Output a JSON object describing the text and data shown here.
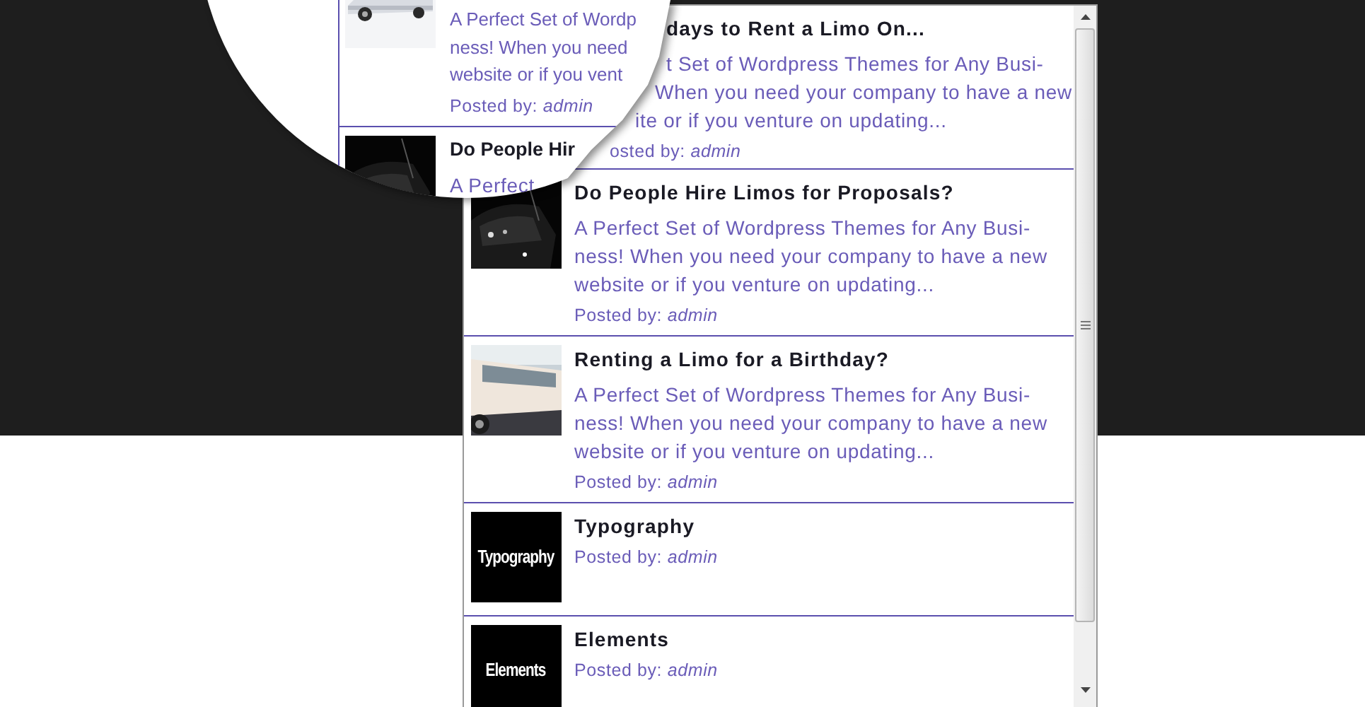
{
  "magnifier": {
    "posts": [
      {
        "kind": "picture_post",
        "excerpt": "A Perfect Set of Wordp\nness! When you need\nwebsite or if you vent",
        "posted_label": "Posted by:",
        "author": "admin"
      },
      {
        "kind": "title_post",
        "title": "Do People Hir",
        "excerpt": "A Perfect"
      }
    ]
  },
  "posts": [
    {
      "kind": "clipped",
      "title": "days to Rent a Limo On...",
      "excerpt_lines": [
        "t Set of Wordpress Themes for Any Busi-",
        "When you need your company to have a new",
        "ite or if you venture on updating..."
      ],
      "posted_label": "osted by:",
      "author": "admin"
    },
    {
      "kind": "full",
      "title": "Do People Hire Limos for Proposals?",
      "excerpt": "A Perfect Set of Wordpress Themes for Any Busi-\nness! When you need your company to have a new\nwebsite or if you venture on updating...",
      "posted_label": "Posted by:",
      "author": "admin"
    },
    {
      "kind": "full",
      "title": "Renting a Limo for a Birthday?",
      "excerpt": "A Perfect Set of Wordpress Themes for Any Busi-\nness! When you need your company to have a new\nwebsite or if you venture on updating...",
      "posted_label": "Posted by:",
      "author": "admin"
    },
    {
      "kind": "short",
      "thumbnail": {
        "kind": "text",
        "text": "Typography"
      },
      "title": "Typography",
      "posted_label": "Posted by:",
      "author": "admin"
    },
    {
      "kind": "short",
      "thumbnail": {
        "kind": "text",
        "text": "Elements"
      },
      "title": "Elements",
      "posted_label": "Posted by:",
      "author": "admin"
    }
  ]
}
